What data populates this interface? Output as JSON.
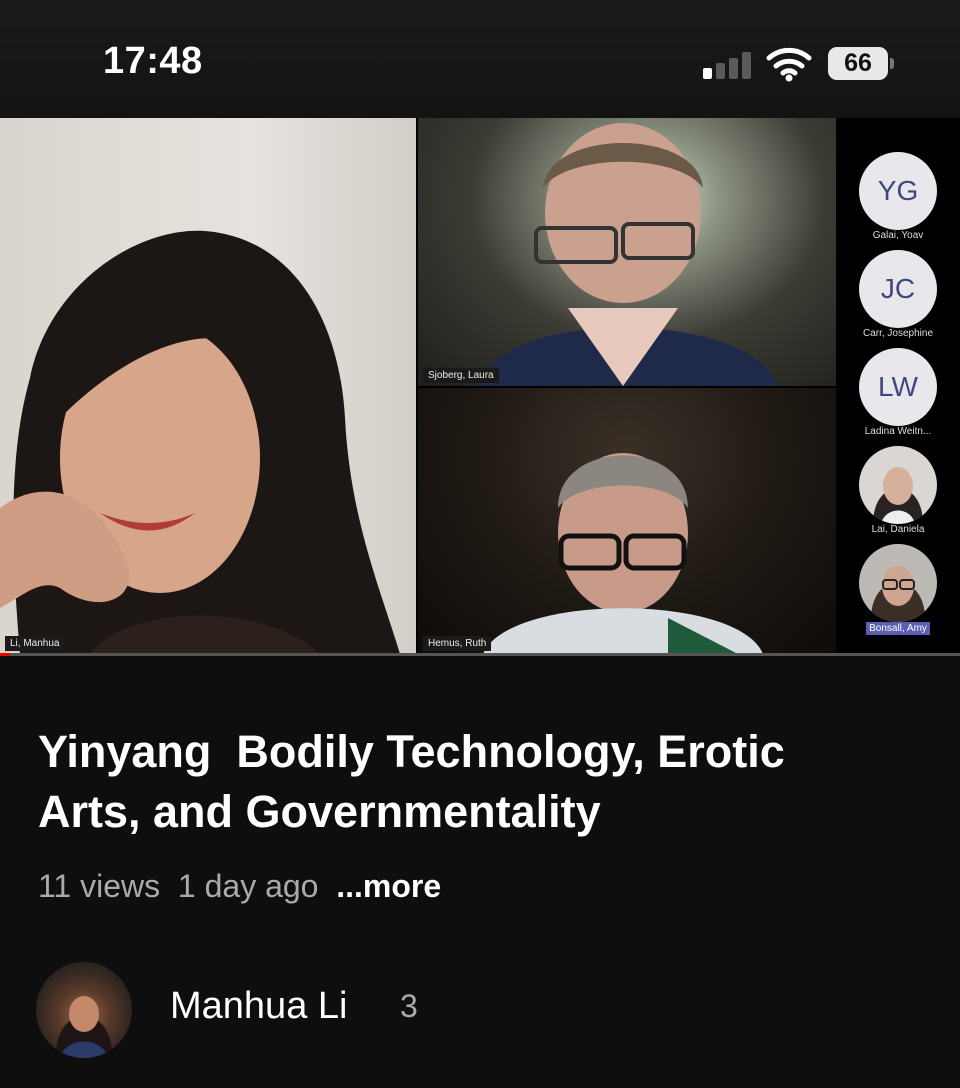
{
  "status_bar": {
    "time": "17:48",
    "battery": "66",
    "signal_bars_active": 1,
    "icons": [
      "cellular-signal-icon",
      "wifi-icon",
      "battery-icon"
    ]
  },
  "video": {
    "tiles": [
      {
        "name": "Li, Manhua"
      },
      {
        "name": "Sjoberg, Laura"
      },
      {
        "name": "Hemus, Ruth"
      }
    ],
    "participants": [
      {
        "initials": "YG",
        "name": "Galai, Yoav"
      },
      {
        "initials": "JC",
        "name": "Carr, Josephine"
      },
      {
        "initials": "LW",
        "name": "Ladina Weitn..."
      },
      {
        "initials": "",
        "name": "Lai, Daniela"
      },
      {
        "initials": "",
        "name": "Bonsall, Amy"
      }
    ],
    "progress_fraction": 0.01
  },
  "title": "Yinyang  Bodily Technology, Erotic\nArts, and Governmentality",
  "meta": {
    "views": "11 views",
    "age": "1 day ago",
    "more": "...more"
  },
  "channel": {
    "name": "Manhua Li",
    "count": "3"
  },
  "colors": {
    "background": "#0e0e0e",
    "avatar_text": "#3d4a80",
    "speaker_highlight": "#5a5fb4"
  }
}
